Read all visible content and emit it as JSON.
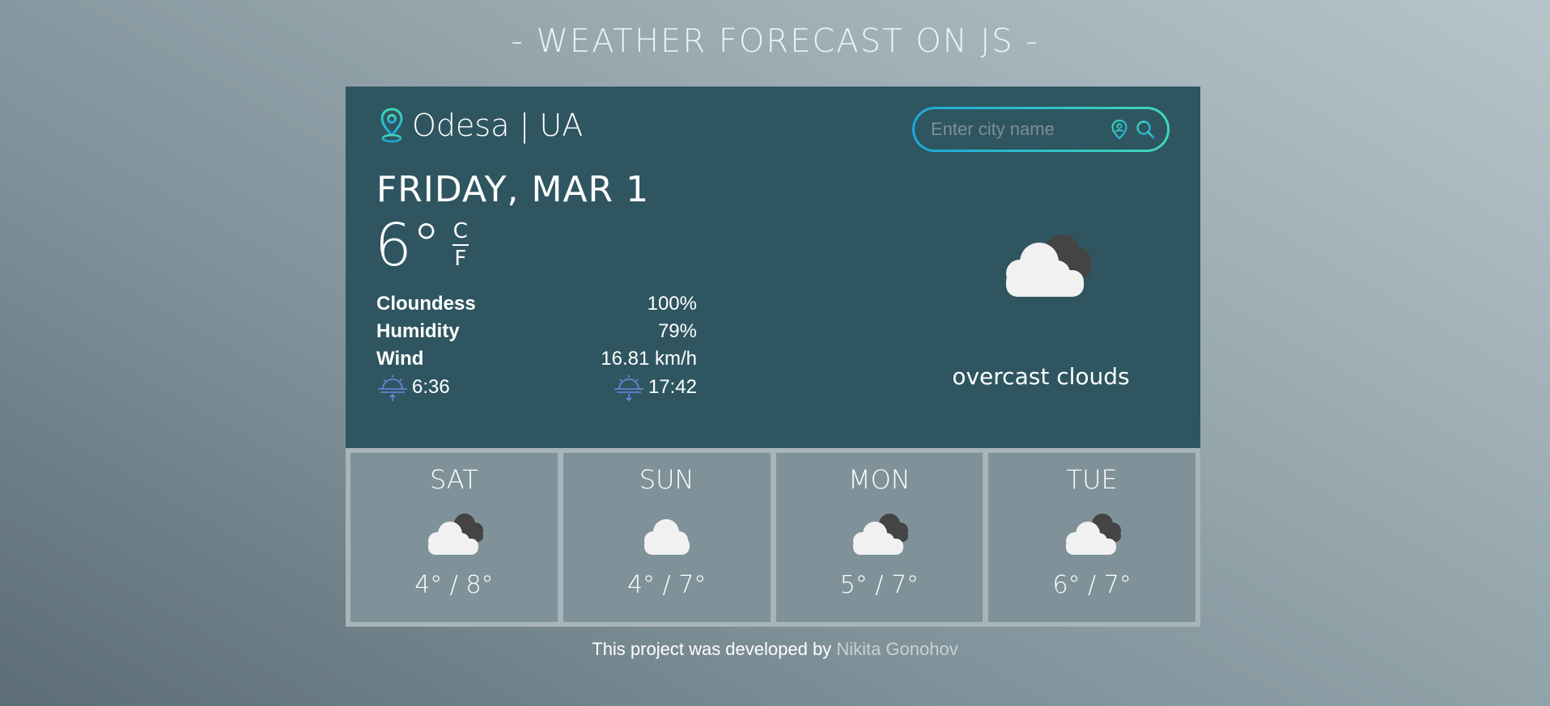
{
  "header": {
    "title": "- WEATHER FORECAST ON JS -"
  },
  "current": {
    "location": "Odesa | UA",
    "date": "FRIDAY, MAR 1",
    "temperature": "6°",
    "unit_c": "C",
    "unit_f": "F",
    "details": [
      {
        "label": "Cloundess",
        "value": "100%"
      },
      {
        "label": "Humidity",
        "value": "79%"
      },
      {
        "label": "Wind",
        "value": "16.81 km/h"
      }
    ],
    "sunrise": "6:36",
    "sunset": "17:42",
    "description": "overcast clouds",
    "icon": "broken-clouds-icon"
  },
  "search": {
    "placeholder": "Enter city name",
    "value": ""
  },
  "forecast": [
    {
      "day": "SAT",
      "range": "4° / 8°",
      "icon": "broken-clouds-icon"
    },
    {
      "day": "SUN",
      "range": "4° / 7°",
      "icon": "cloud-icon"
    },
    {
      "day": "MON",
      "range": "5° / 7°",
      "icon": "broken-clouds-icon"
    },
    {
      "day": "TUE",
      "range": "6° / 7°",
      "icon": "broken-clouds-icon"
    }
  ],
  "footer": {
    "text": "This project was developed by",
    "author": "Nikita Gonohov"
  },
  "colors": {
    "card": "#2f5660",
    "forecast_bg": "#a7b4b9",
    "day_card": "#7f9299",
    "search_gradient_start": "#1fa7d9",
    "search_gradient_end": "#3fd8b8",
    "sun_icon": "#6f86e0"
  }
}
